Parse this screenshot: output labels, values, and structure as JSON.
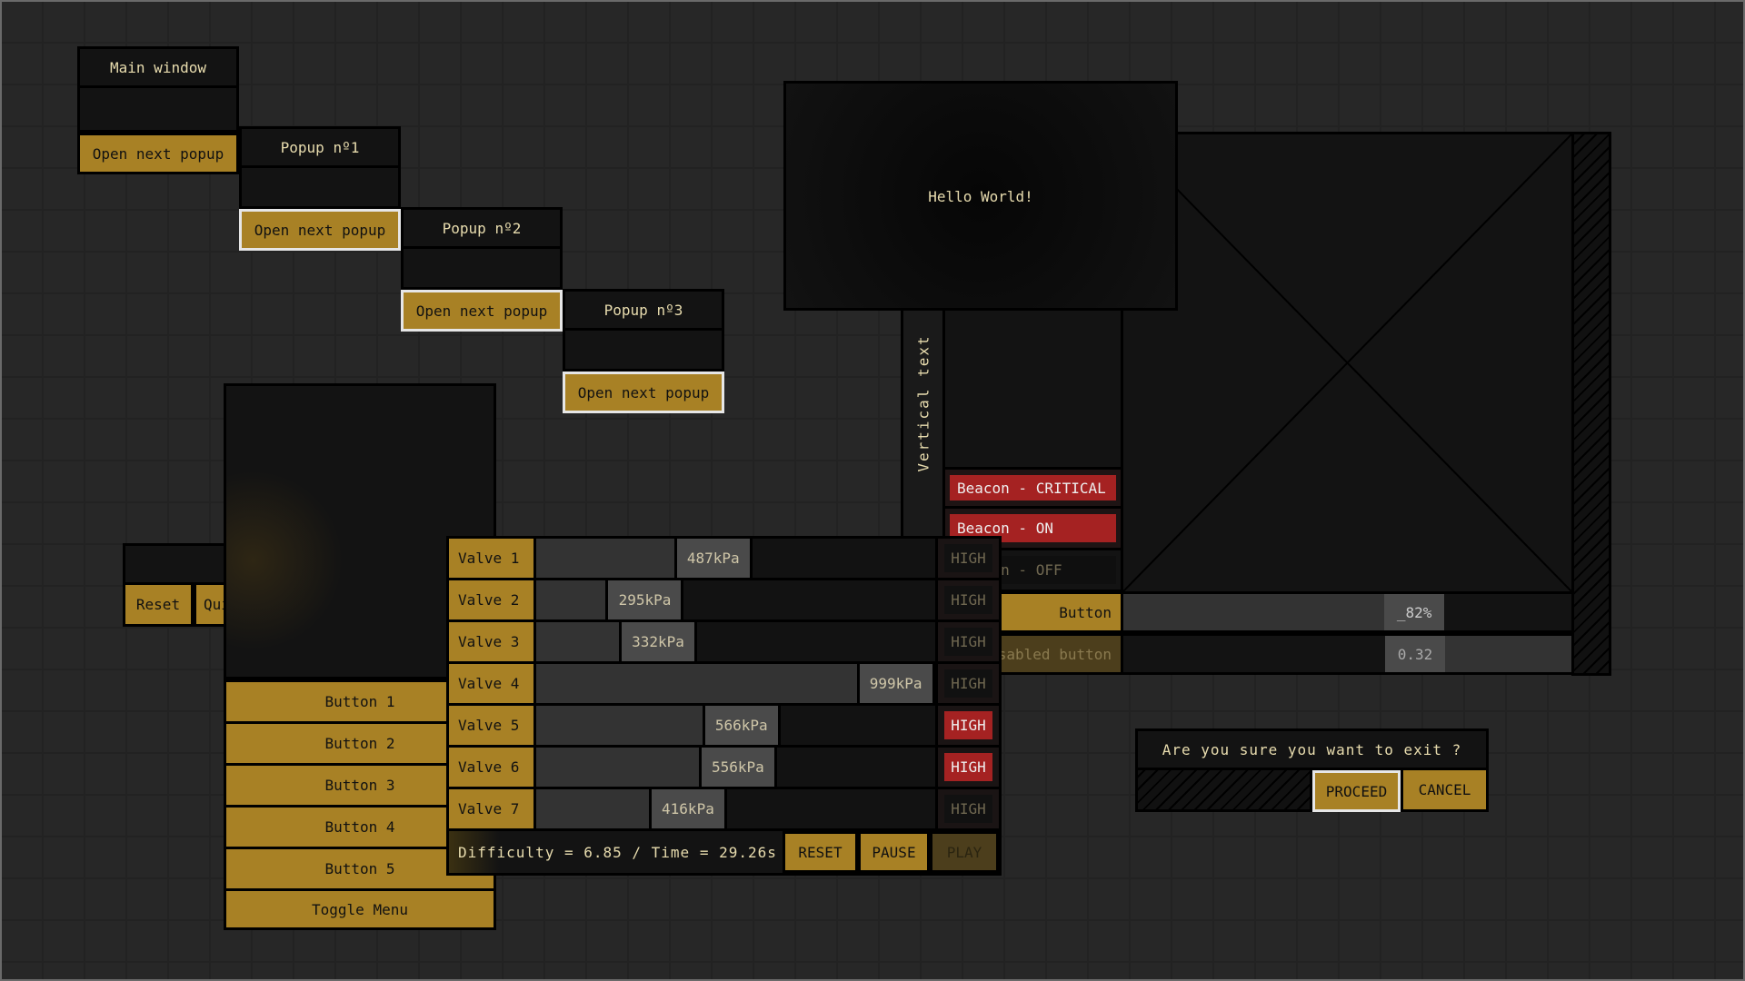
{
  "colors": {
    "accent": "#a88125",
    "panel": "#131313",
    "danger": "#a52222",
    "text": "#e8dcae"
  },
  "main_window": {
    "title": "Main window",
    "button": "Open next popup"
  },
  "popups": [
    {
      "title": "Popup nº1",
      "button": "Open next popup"
    },
    {
      "title": "Popup nº2",
      "button": "Open next popup"
    },
    {
      "title": "Popup nº3",
      "button": "Open next popup"
    }
  ],
  "hello": {
    "text": "Hello World!"
  },
  "vertical": {
    "text": "Vertical text"
  },
  "beacons": [
    {
      "label": "Beacon - CRITICAL",
      "state": "on"
    },
    {
      "label": "Beacon - ON",
      "state": "on"
    },
    {
      "label": "Beacon - OFF",
      "state": "off"
    }
  ],
  "controls": {
    "button": "Button",
    "slider_value": "_82%",
    "slider_fraction": 0.82,
    "disabled_button": "Disabled button",
    "disabled_value": "0.32",
    "disabled_fraction": 0.32
  },
  "dialog": {
    "message": "Are you sure you want to exit ?",
    "proceed": "PROCEED",
    "cancel": "CANCEL"
  },
  "small_window": {
    "reset": "Reset",
    "quit": "Quit"
  },
  "menu": {
    "buttons": [
      "Button 1",
      "Button 2",
      "Button 3",
      "Button 4",
      "Button 5"
    ],
    "toggle": "Toggle Menu"
  },
  "valves": {
    "range": [
      100,
      1000
    ],
    "high_label": "HIGH",
    "rows": [
      {
        "label": "Valve 1",
        "value": 487,
        "text": "487kPa",
        "high": false
      },
      {
        "label": "Valve 2",
        "value": 295,
        "text": "295kPa",
        "high": false
      },
      {
        "label": "Valve 3",
        "value": 332,
        "text": "332kPa",
        "high": false
      },
      {
        "label": "Valve 4",
        "value": 999,
        "text": "999kPa",
        "high": false
      },
      {
        "label": "Valve 5",
        "value": 566,
        "text": "566kPa",
        "high": true
      },
      {
        "label": "Valve 6",
        "value": 556,
        "text": "556kPa",
        "high": true
      },
      {
        "label": "Valve 7",
        "value": 416,
        "text": "416kPa",
        "high": false
      }
    ],
    "status": "Difficulty = 6.85 / Time = 29.26s",
    "reset": "RESET",
    "pause": "PAUSE",
    "play": "PLAY"
  }
}
